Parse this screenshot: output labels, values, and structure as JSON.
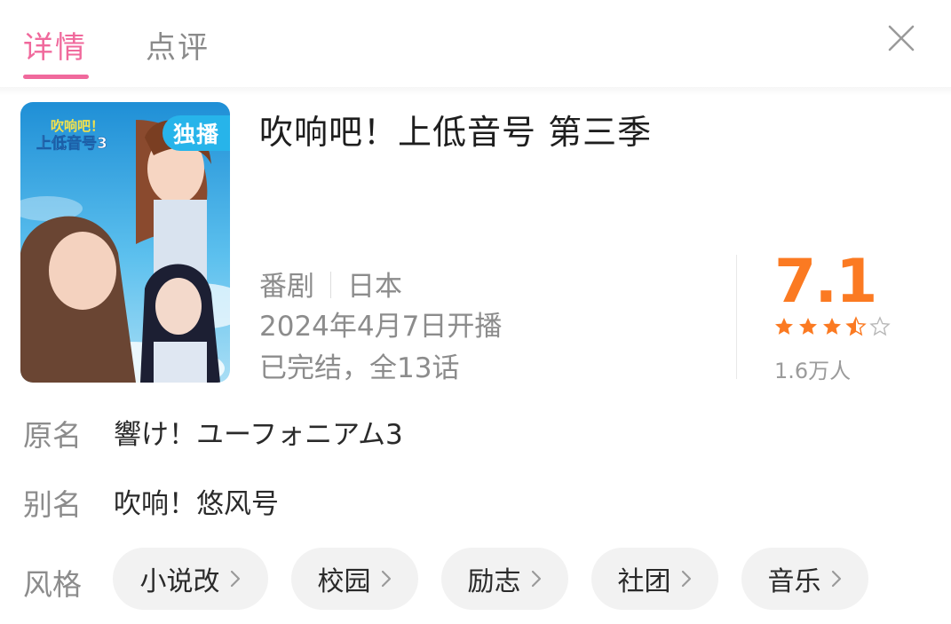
{
  "tabs": [
    {
      "label": "详情",
      "active": true
    },
    {
      "label": "点评",
      "active": false
    }
  ],
  "poster": {
    "badge": "独播",
    "logo_line1": "吹响吧！",
    "logo_line2": "上低音号3"
  },
  "title": "吹响吧！上低音号 第三季",
  "meta": {
    "category": "番剧",
    "region": "日本",
    "premiere": "2024年4月7日开播",
    "status": "已完结，全13话"
  },
  "rating": {
    "score": "7.1",
    "stars_value": 3.5,
    "stars_max": 5,
    "count": "1.6万人",
    "color": "#fb7a22"
  },
  "info": {
    "original_name_label": "原名",
    "original_name": "響け！ユーフォニアム3",
    "alias_label": "别名",
    "alias": "吹响！悠风号",
    "genre_label": "风格"
  },
  "genres": [
    "小说改",
    "校园",
    "励志",
    "社团",
    "音乐"
  ],
  "colors": {
    "accent": "#f0699c",
    "badge": "#27b4ea",
    "score": "#fb7a22"
  },
  "icons": {
    "close": "close-icon",
    "star": "star-icon",
    "chevron": "chevron-right-icon"
  }
}
